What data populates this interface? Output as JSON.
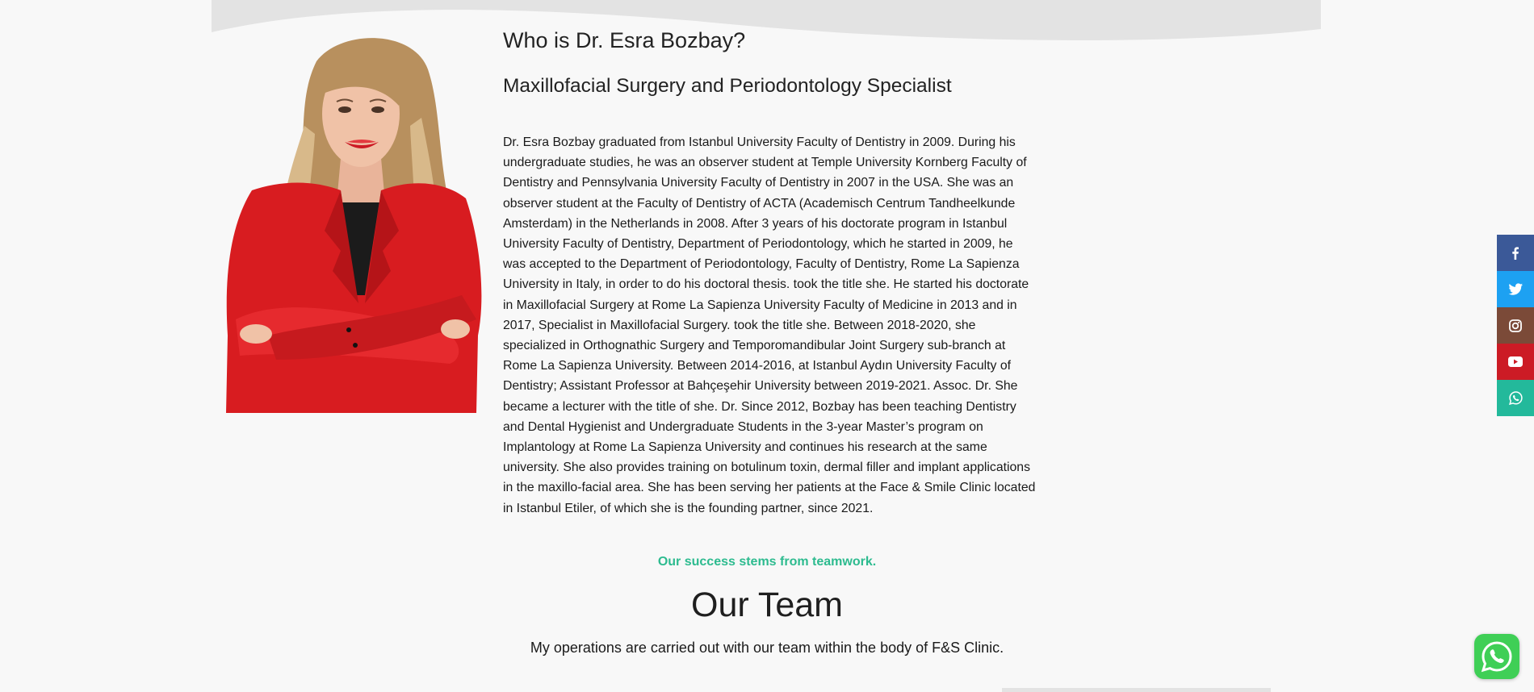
{
  "profile": {
    "heading": "Who is Dr. Esra Bozbay?",
    "subheading": "Maxillofacial Surgery and Periodontology Specialist",
    "bio": "Dr. Esra Bozbay graduated from Istanbul University Faculty of Dentistry in 2009. During his undergraduate studies, he was an observer student at Temple University Kornberg Faculty of Dentistry and Pennsylvania University Faculty of Dentistry in 2007 in the USA. She was an observer student at the Faculty of Dentistry of ACTA (Academisch Centrum Tandheelkunde Amsterdam) in the Netherlands in 2008. After 3 years of his doctorate program in Istanbul University Faculty of Dentistry, Department of Periodontology, which he started in 2009, he was accepted to the Department of Periodontology, Faculty of Dentistry, Rome La Sapienza University in Italy, in order to do his doctoral thesis. took the title she. He started his doctorate in Maxillofacial Surgery at Rome La Sapienza University Faculty of Medicine in 2013 and in 2017, Specialist in Maxillofacial Surgery. took the title she. Between 2018-2020, she specialized in Orthognathic Surgery and Temporomandibular Joint Surgery sub-branch at Rome La Sapienza University. Between 2014-2016, at Istanbul Aydın University Faculty of Dentistry; Assistant Professor at Bahçeşehir University between 2019-2021. Assoc. Dr. She became a lecturer with the title of she. Dr. Since 2012, Bozbay has been teaching Dentistry and Dental Hygienist and Undergraduate Students in the 3-year Master’s program on Implantology at Rome La Sapienza University and continues his research at the same university. She also provides training on botulinum toxin, dermal filler and implant applications in the maxillo-facial area. She has been serving her patients at the Face & Smile Clinic located in Istanbul Etiler, of which she is the founding partner, since 2021."
  },
  "team": {
    "kicker": "Our success stems from teamwork.",
    "title": "Our Team",
    "description": "My operations are carried out with our team within the body of F&S Clinic."
  },
  "social": [
    {
      "name": "facebook",
      "icon": "facebook-icon",
      "color": "#3b5998"
    },
    {
      "name": "twitter",
      "icon": "twitter-icon",
      "color": "#1da1f2"
    },
    {
      "name": "instagram",
      "icon": "instagram-icon",
      "color": "#7b4a38"
    },
    {
      "name": "youtube",
      "icon": "youtube-icon",
      "color": "#cc1b25"
    },
    {
      "name": "whatsapp",
      "icon": "whatsapp-icon",
      "color": "#23b99b"
    }
  ],
  "colors": {
    "accent": "#2dbb8f",
    "background": "#f8f8f8",
    "whatsapp_float": "#3fcf56"
  }
}
